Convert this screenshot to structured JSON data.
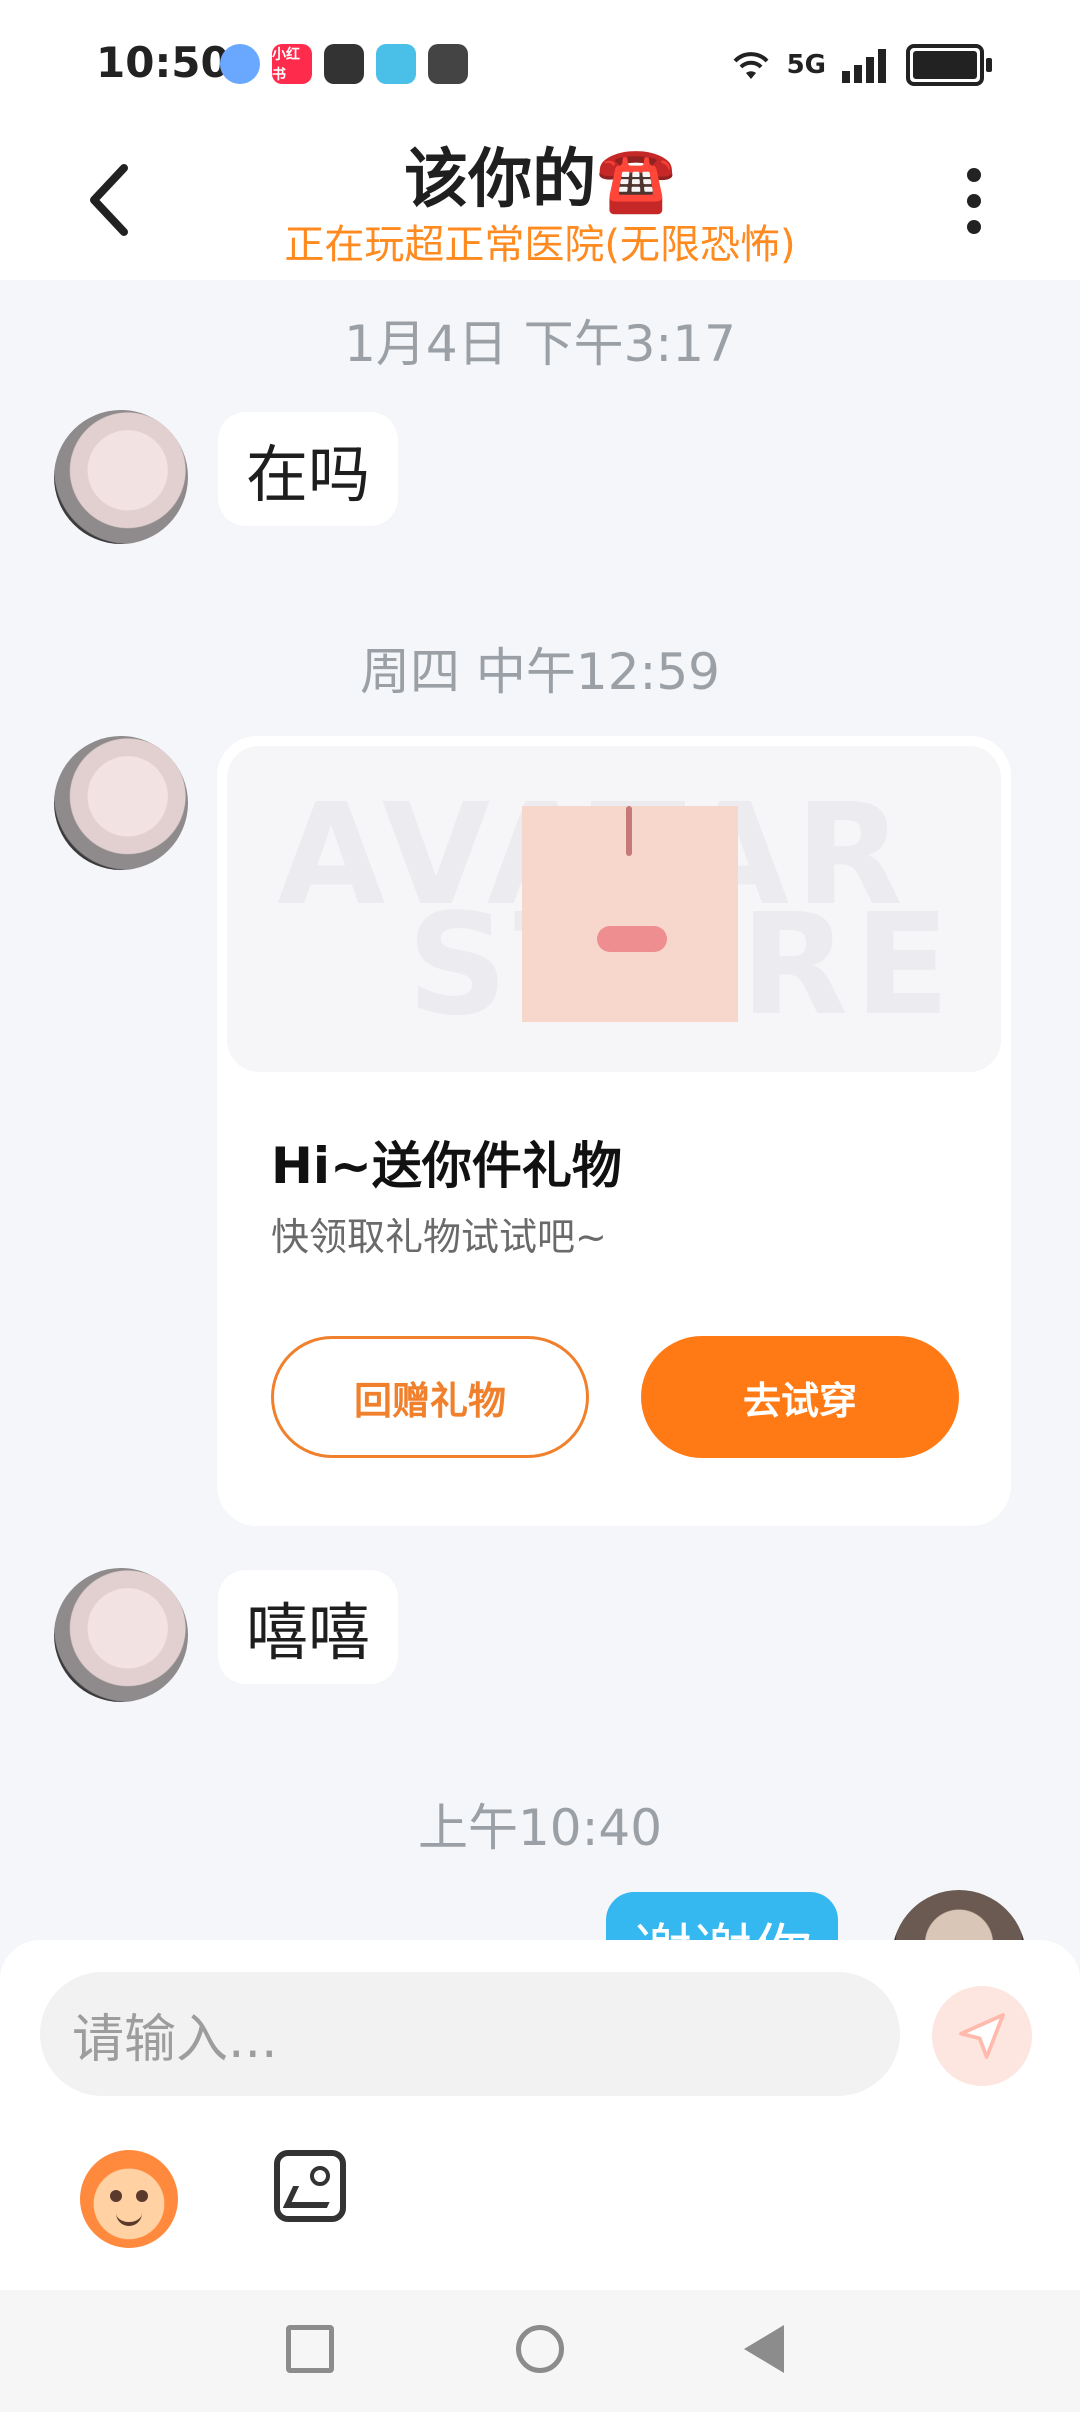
{
  "status": {
    "time": "10:50",
    "icons": [
      "browser-icon",
      "xiaohongshu-icon",
      "shield-icon",
      "book-icon",
      "upload-icon"
    ],
    "xiaohongshu_text": "小红书",
    "right": {
      "wifi": "wifi-icon",
      "network": "5G",
      "battery": "battery-icon"
    }
  },
  "header": {
    "title": "该你的☎️",
    "subtitle": "正在玩超正常医院(无限恐怖)"
  },
  "messages": {
    "ts1": "1月4日 下午3:17",
    "m1": "在吗",
    "ts2": "周四 中午12:59",
    "gift_card": {
      "watermark_line1": "AVATAR",
      "watermark_line2": "STORE",
      "title": "Hi~送你件礼物",
      "subtitle": "快领取礼物试试吧~",
      "btn_return": "回赠礼物",
      "btn_try": "去试穿"
    },
    "m2": "嘻嘻",
    "ts3": "上午10:40",
    "outgoing": "谢谢你"
  },
  "input": {
    "placeholder": "请输入..."
  },
  "colors": {
    "accent_orange": "#ff7a14",
    "subtitle_orange": "#ff8a1f",
    "bubble_out": "#35b8ef",
    "send_bg": "#fde5e0"
  }
}
